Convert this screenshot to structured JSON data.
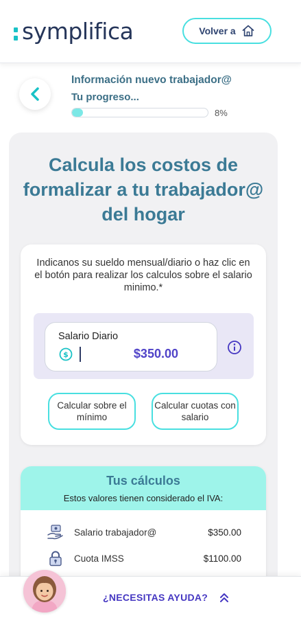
{
  "header": {
    "logo_text": "symplifica",
    "back_home_label": "Volver a"
  },
  "progress": {
    "title": "Información nuevo trabajador@",
    "subtitle": "Tu progreso...",
    "value": 0.08,
    "percent_label": "8%"
  },
  "main": {
    "title": "Calcula los costos de formalizar a tu trabajador@ del hogar",
    "instructions": "Indicanos su sueldo mensual/diario o haz clic en el botón para realizar los calculos sobre el salario minimo.*",
    "salary_field": {
      "label": "Salario Diario",
      "value": "$350.00"
    },
    "buttons": {
      "calc_minimum": "Calcular sobre el mínimo",
      "calc_salary": "Calcular cuotas con salario"
    }
  },
  "calculations": {
    "title": "Tus cálculos",
    "note": "Estos valores tienen considerado el IVA:",
    "rows": [
      {
        "icon": "salary-hand-icon",
        "label": "Salario trabajador@",
        "value": "$350.00"
      },
      {
        "icon": "lock-icon",
        "label": "Cuota IMSS",
        "value": "$1100.00"
      }
    ]
  },
  "help": {
    "label": "¿NECESITAS AYUDA?"
  },
  "colors": {
    "accent": "#48dfe0",
    "title": "#3b7a95",
    "purple": "#5043c8",
    "calc_header": "#9ef4ea"
  }
}
